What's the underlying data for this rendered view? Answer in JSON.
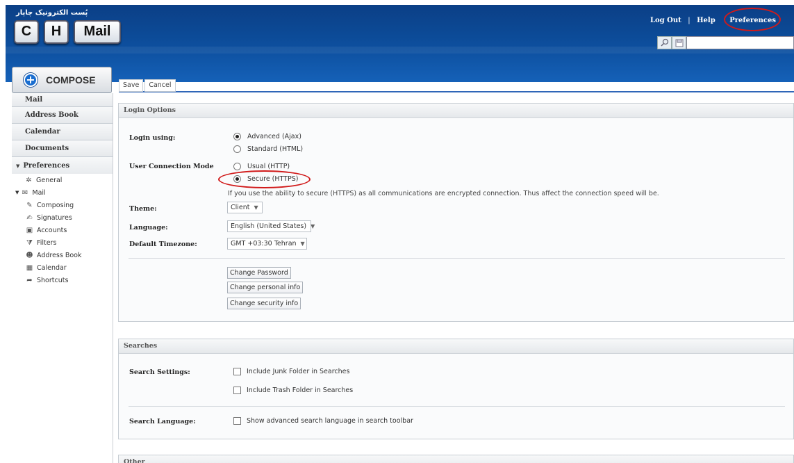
{
  "header": {
    "brand_fa": "پُست الکترونیک چاپار",
    "logo_keys": [
      "C",
      "H",
      "Mail"
    ],
    "links": [
      "Log Out",
      "Help",
      "Preferences"
    ],
    "link_separator": "|"
  },
  "compose": {
    "label": "COMPOSE"
  },
  "sidebar": {
    "nav": [
      "Mail",
      "Address Book",
      "Calendar",
      "Documents"
    ],
    "preferences_label": "Preferences",
    "tree": {
      "general": "General",
      "mail": "Mail",
      "children": [
        "Composing",
        "Signatures",
        "Accounts",
        "Filters",
        "Address Book",
        "Calendar",
        "Shortcuts"
      ]
    }
  },
  "toolbar": {
    "save": "Save",
    "cancel": "Cancel"
  },
  "login_options": {
    "title": "Login Options",
    "login_using_label": "Login using:",
    "login_using_options": [
      {
        "label": "Advanced (Ajax)",
        "checked": true
      },
      {
        "label": "Standard (HTML)",
        "checked": false
      }
    ],
    "connection_mode_label": "User Connection Mode",
    "connection_mode_options": [
      {
        "label": "Usual (HTTP)",
        "checked": false
      },
      {
        "label": "Secure (HTTPS)",
        "checked": true
      }
    ],
    "https_note": "If you use the ability to secure (HTTPS) as all communications are encrypted connection. Thus affect the connection speed will be.",
    "theme_label": "Theme:",
    "theme_value": "Client",
    "language_label": "Language:",
    "language_value": "English (United States)",
    "timezone_label": "Default Timezone:",
    "timezone_value": "GMT +03:30 Tehran",
    "buttons": [
      "Change Password",
      "Change personal info",
      "Change security info"
    ]
  },
  "searches": {
    "title": "Searches",
    "settings_label": "Search Settings:",
    "include_junk": "Include Junk Folder in Searches",
    "include_trash": "Include Trash Folder in Searches",
    "language_label": "Search Language:",
    "show_advanced": "Show advanced search language in search toolbar"
  },
  "other": {
    "title": "Other"
  },
  "colors": {
    "header_blue": "#0d4f9e",
    "annotation_red": "#d11a1a",
    "accent_blue": "#2f66b8"
  }
}
